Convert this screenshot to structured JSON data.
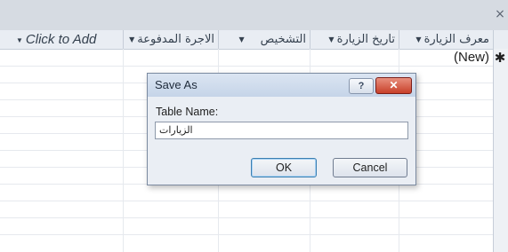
{
  "window": {
    "close_glyph": "×"
  },
  "columns": [
    {
      "label": "معرف الزيارة",
      "has_dropdown": true
    },
    {
      "label": "تاريخ الزيارة",
      "has_dropdown": true
    },
    {
      "label": "التشخيص",
      "has_dropdown": true
    },
    {
      "label": "الاجرة المدفوعة",
      "has_dropdown": true
    },
    {
      "label": "Click to Add",
      "has_dropdown": true
    }
  ],
  "dropdown_glyph": "▼",
  "new_row": {
    "label": "(New)",
    "marker": "✱"
  },
  "dialog": {
    "title": "Save As",
    "help_glyph": "?",
    "close_glyph": "✕",
    "field_label": "Table Name:",
    "field_value": "الزيارات",
    "ok_label": "OK",
    "cancel_label": "Cancel"
  },
  "colors": {
    "header_bg": "#e9edf3",
    "dialog_bg": "#eaeef4",
    "close_btn": "#c8402a"
  }
}
